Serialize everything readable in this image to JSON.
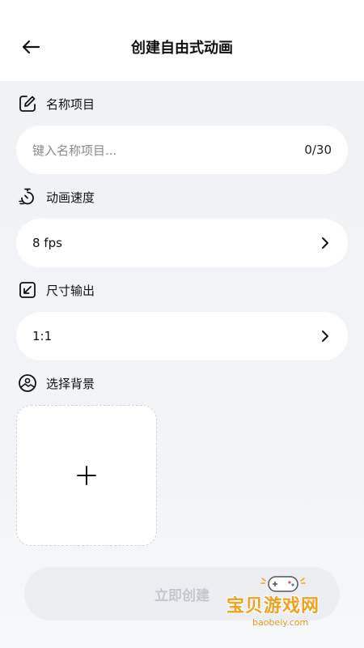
{
  "header": {
    "title": "创建自由式动画",
    "back_icon": "arrow-left-icon"
  },
  "sections": {
    "name": {
      "label": "名称项目",
      "icon": "edit-icon",
      "placeholder": "键入名称项目...",
      "counter": "0/30"
    },
    "speed": {
      "label": "动画速度",
      "icon": "timer-icon",
      "value": "8 fps"
    },
    "size": {
      "label": "尺寸输出",
      "icon": "resize-icon",
      "value": "1:1"
    },
    "background": {
      "label": "选择背景",
      "icon": "image-icon",
      "add_icon": "plus-icon"
    }
  },
  "create_button": {
    "label": "立即创建",
    "enabled": false
  },
  "watermark": {
    "text": "宝贝游戏网",
    "domain": "baobeiy.com"
  },
  "colors": {
    "background": "#f0f2f6",
    "card": "#ffffff",
    "text": "#111111",
    "placeholder": "#8a8a8a",
    "disabled_button": "#eceef2",
    "disabled_text": "#c4c7cd",
    "watermark": "#f0a020"
  }
}
